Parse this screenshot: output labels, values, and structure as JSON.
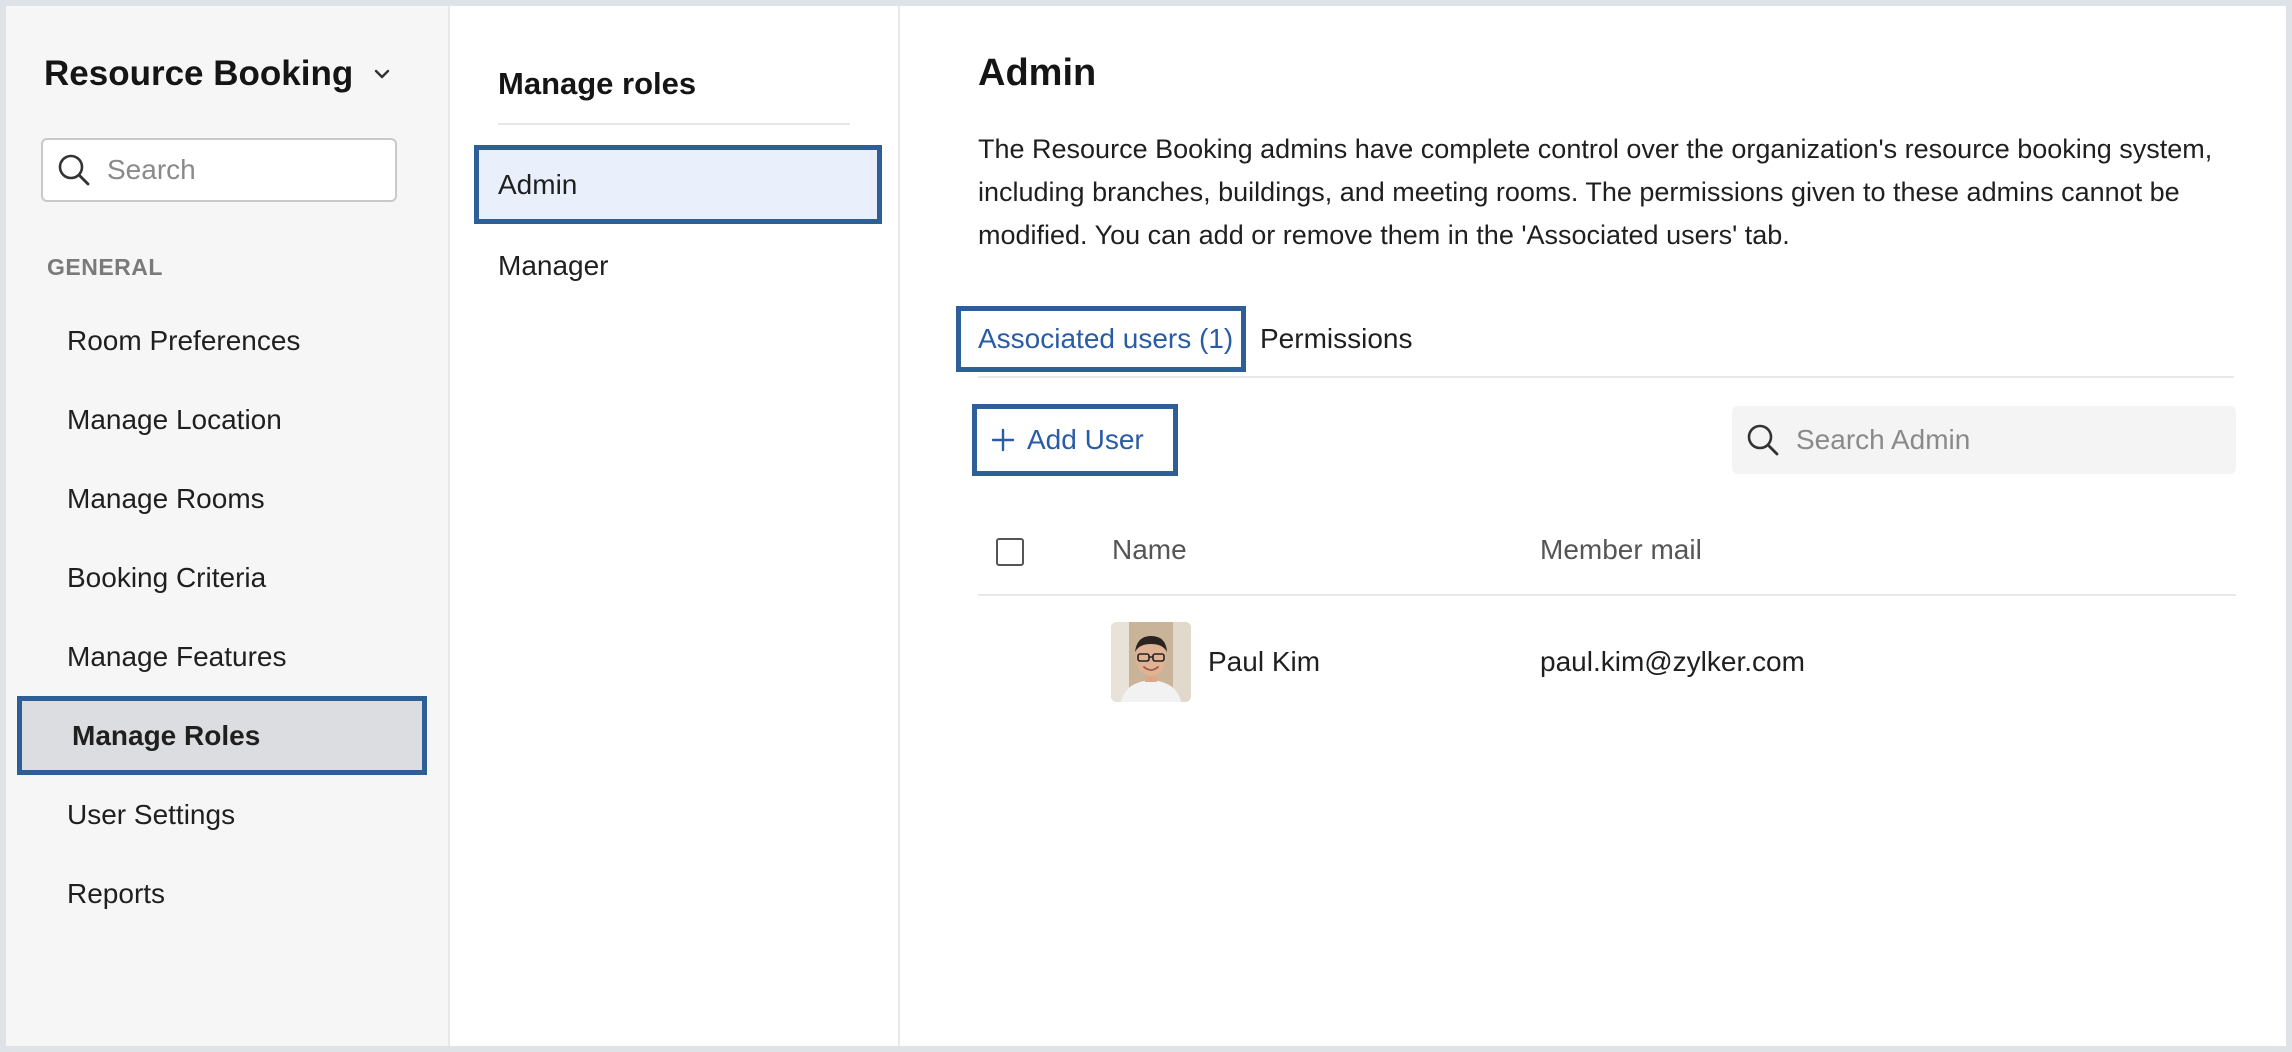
{
  "sidebar": {
    "app_title": "Resource Booking",
    "search": {
      "placeholder": "Search",
      "value": ""
    },
    "section_label": "GENERAL",
    "items": [
      {
        "label": "Room Preferences"
      },
      {
        "label": "Manage Location"
      },
      {
        "label": "Manage Rooms"
      },
      {
        "label": "Booking Criteria"
      },
      {
        "label": "Manage Features"
      },
      {
        "label": "Manage Roles",
        "active": true
      },
      {
        "label": "User Settings"
      },
      {
        "label": "Reports"
      }
    ]
  },
  "roles_panel": {
    "title": "Manage roles",
    "items": [
      {
        "label": "Admin",
        "active": true
      },
      {
        "label": "Manager"
      }
    ]
  },
  "main": {
    "title": "Admin",
    "description": "The Resource Booking admins have complete control over the organization's resource booking system, including branches, buildings, and meeting rooms. The permissions given to these admins cannot be modified. You can add or remove them in the 'Associated users' tab.",
    "tabs": [
      {
        "label": "Associated users (1)",
        "active": true
      },
      {
        "label": "Permissions"
      }
    ],
    "add_user_label": "Add User",
    "search_admin": {
      "placeholder": "Search Admin",
      "value": ""
    },
    "table": {
      "columns": [
        "Name",
        "Member mail"
      ],
      "rows": [
        {
          "name": "Paul Kim",
          "mail": "paul.kim@zylker.com"
        }
      ]
    }
  },
  "colors": {
    "highlight_border": "#2d5f96",
    "accent_text": "#2a5ba5",
    "sidebar_bg": "#f6f6f6",
    "active_role_bg": "#e9f0fb",
    "active_nav_bg": "#dcdde1"
  }
}
